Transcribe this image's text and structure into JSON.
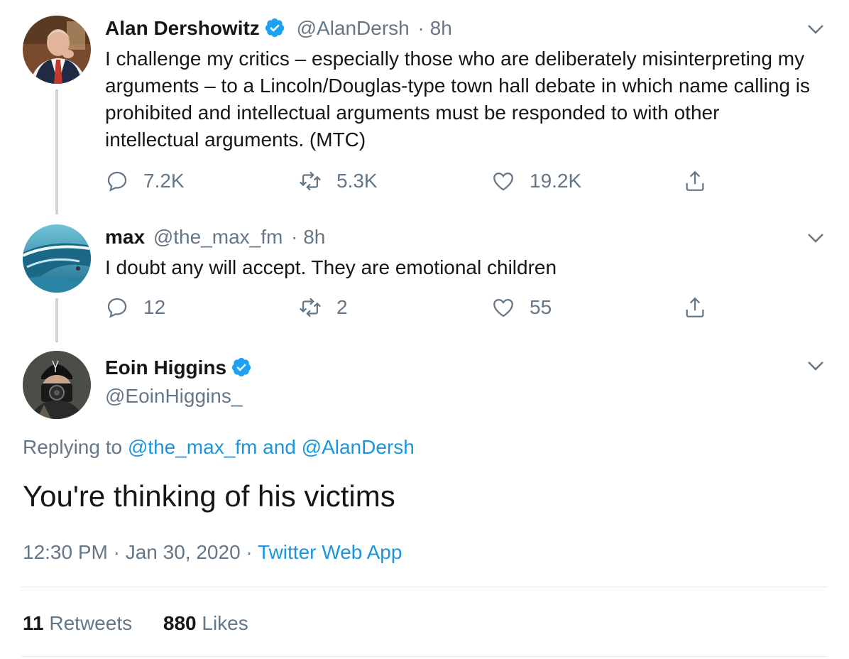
{
  "tweet1": {
    "name": "Alan Dershowitz",
    "handle": "@AlanDersh",
    "time": "· 8h",
    "text": "I challenge my critics – especially those who are deliberately misinterpreting my arguments – to a Lincoln/Douglas-type town hall debate in which name calling is prohibited and intellectual arguments must be responded to with other intellectual arguments.  (MTC)",
    "replies": "7.2K",
    "retweets": "5.3K",
    "likes": "19.2K"
  },
  "tweet2": {
    "name": "max",
    "handle": "@the_max_fm",
    "time": "· 8h",
    "text": "I doubt any will accept. They are emotional children",
    "replies": "12",
    "retweets": "2",
    "likes": "55"
  },
  "main_tweet": {
    "name": "Eoin Higgins",
    "handle": "@EoinHiggins_",
    "replying_prefix": "Replying to",
    "reply_mention_1": "@the_max_fm",
    "reply_and": "and",
    "reply_mention_2": "@AlanDersh",
    "text": "You're thinking of his victims",
    "timestamp": "12:30 PM · Jan 30, 2020 ·",
    "source": "Twitter Web App",
    "retweet_count": "11",
    "retweet_label": "Retweets",
    "like_count": "880",
    "like_label": "Likes"
  },
  "colors": {
    "accent": "#1b95e0",
    "muted": "#657786",
    "text": "#14171a",
    "verified": "#1da1f2"
  },
  "icons": [
    "reply-icon",
    "retweet-icon",
    "like-icon",
    "share-icon",
    "chevron-down-icon",
    "verified-icon"
  ]
}
